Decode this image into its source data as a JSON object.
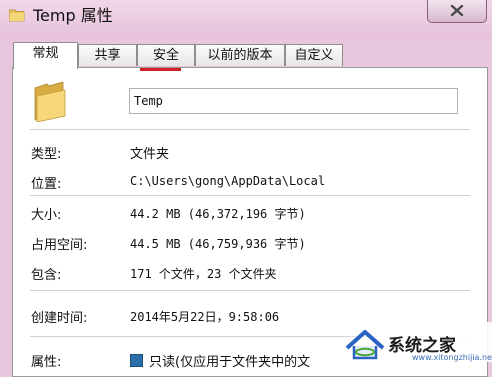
{
  "window": {
    "title": "Temp 属性"
  },
  "tabs": [
    {
      "label": "常规"
    },
    {
      "label": "共享"
    },
    {
      "label": "安全"
    },
    {
      "label": "以前的版本"
    },
    {
      "label": "自定义"
    }
  ],
  "general": {
    "name_value": "Temp",
    "type_label": "类型:",
    "type_value": "文件夹",
    "location_label": "位置:",
    "location_value": "C:\\Users\\gong\\AppData\\Local",
    "size_label": "大小:",
    "size_value": "44.2 MB (46,372,196 字节)",
    "disk_size_label": "占用空间:",
    "disk_size_value": "44.5 MB (46,759,936 字节)",
    "contains_label": "包含:",
    "contains_value": "171 个文件，23 个文件夹",
    "created_label": "创建时间:",
    "created_value": "2014年5月22日，9:58:06",
    "attributes_label": "属性:",
    "readonly_label": "只读(仅应用于文件夹中的文"
  },
  "watermark": {
    "site_name": "系统之家",
    "url": "www.xitongzhijia.net"
  }
}
